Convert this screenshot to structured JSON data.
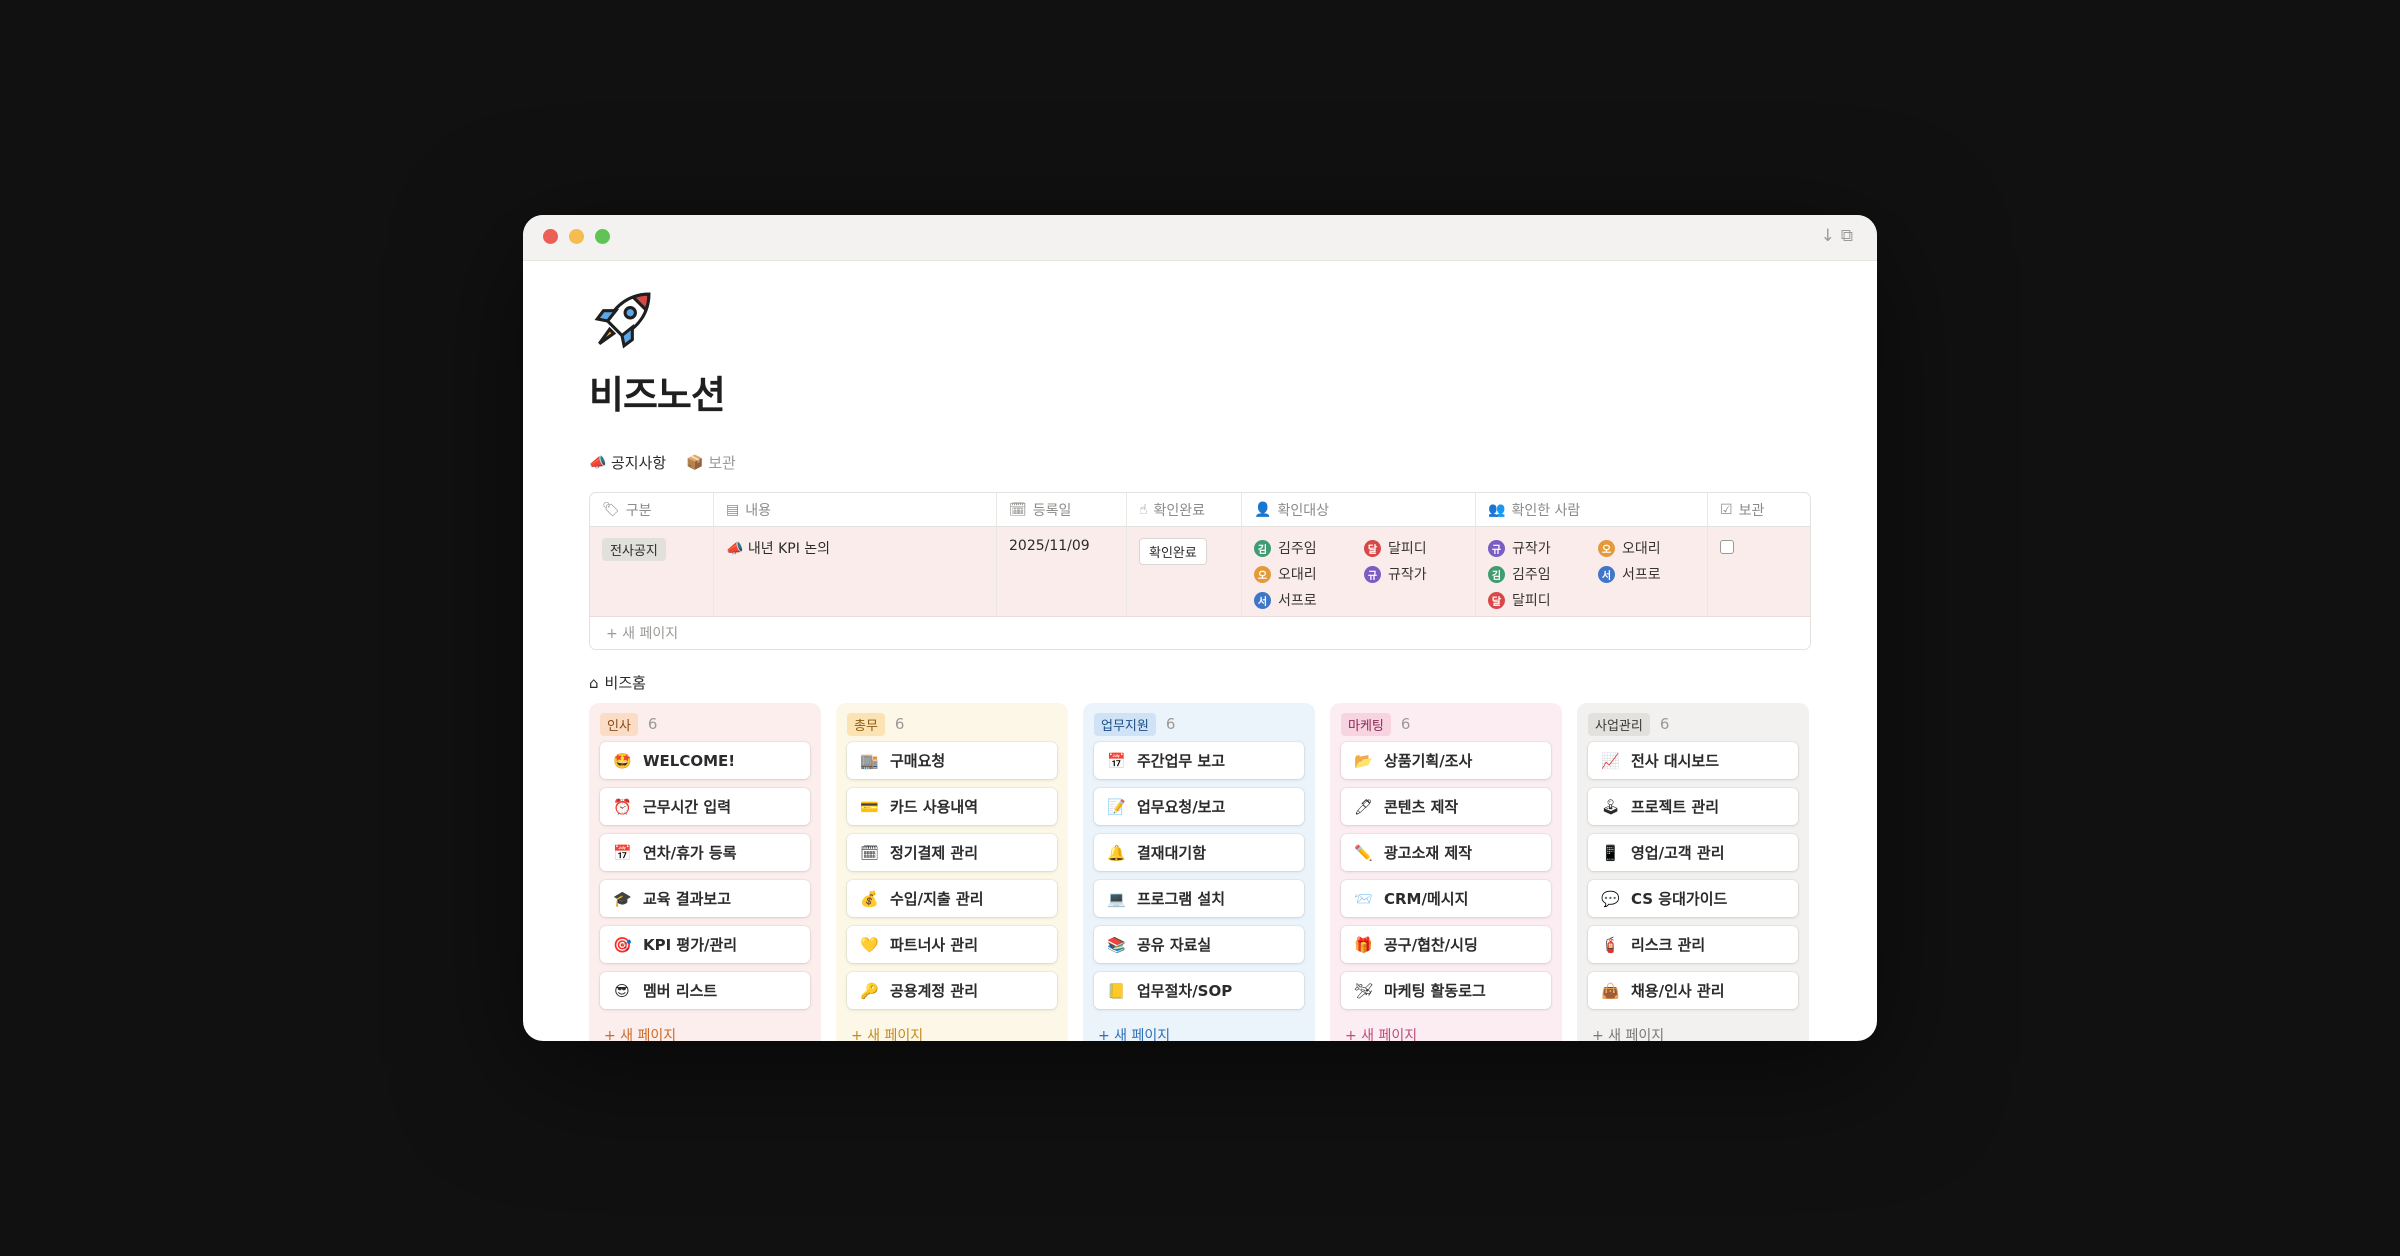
{
  "page": {
    "title": "비즈노션"
  },
  "tabs": [
    {
      "label": "공지사항",
      "icon": "megaphone-icon"
    },
    {
      "label": "보관",
      "icon": "box-icon"
    }
  ],
  "notice_table": {
    "columns": [
      "구분",
      "내용",
      "등록일",
      "확인완료",
      "확인대상",
      "확인한 사람",
      "보관"
    ],
    "rows": [
      {
        "category": "전사공지",
        "content": "내년 KPI 논의",
        "date": "2025/11/09",
        "confirm_button": "확인완료",
        "targets": [
          {
            "name": "김주임",
            "initial": "김",
            "color": "#3e9e72"
          },
          {
            "name": "달피디",
            "initial": "달",
            "color": "#d94848"
          },
          {
            "name": "오대리",
            "initial": "오",
            "color": "#e49a3a"
          },
          {
            "name": "규작가",
            "initial": "규",
            "color": "#7b5cc4"
          },
          {
            "name": "서프로",
            "initial": "서",
            "color": "#3f76c9"
          }
        ],
        "confirmed_by": [
          {
            "name": "규작가",
            "initial": "규",
            "color": "#7b5cc4"
          },
          {
            "name": "오대리",
            "initial": "오",
            "color": "#e49a3a"
          },
          {
            "name": "김주임",
            "initial": "김",
            "color": "#3e9e72"
          },
          {
            "name": "서프로",
            "initial": "서",
            "color": "#3f76c9"
          },
          {
            "name": "달피디",
            "initial": "달",
            "color": "#d94848"
          }
        ]
      }
    ],
    "new_page": "+ 새 페이지"
  },
  "bizhome": {
    "label": "비즈홈",
    "new_page": "+ 새 페이지",
    "columns": [
      {
        "name": "인사",
        "count": "6",
        "bg": "#fbeeec",
        "tag_bg": "#fbdcc4",
        "tag_color": "#8a4b18",
        "new_color": "#c96a2a",
        "cards": [
          {
            "label": "WELCOME!",
            "icon": "🤩"
          },
          {
            "label": "근무시간 입력",
            "icon": "⏰"
          },
          {
            "label": "연차/휴가 등록",
            "icon": "📅"
          },
          {
            "label": "교육 결과보고",
            "icon": "🎓"
          },
          {
            "label": "KPI 평가/관리",
            "icon": "🎯"
          },
          {
            "label": "멤버 리스트",
            "icon": "😎"
          }
        ]
      },
      {
        "name": "총무",
        "count": "6",
        "bg": "#fcf7e6",
        "tag_bg": "#fbe3b3",
        "tag_color": "#8a5a10",
        "new_color": "#c48a1f",
        "cards": [
          {
            "label": "구매요청",
            "icon": "🏬"
          },
          {
            "label": "카드 사용내역",
            "icon": "💳"
          },
          {
            "label": "정기결제 관리",
            "icon": "🗓"
          },
          {
            "label": "수입/지출 관리",
            "icon": "💰"
          },
          {
            "label": "파트너사 관리",
            "icon": "💛"
          },
          {
            "label": "공용계정 관리",
            "icon": "🔑"
          }
        ]
      },
      {
        "name": "업무지원",
        "count": "6",
        "bg": "#ebf3fb",
        "tag_bg": "#cfe2f6",
        "tag_color": "#1e4f86",
        "new_color": "#2f6fb8",
        "cards": [
          {
            "label": "주간업무 보고",
            "icon": "📅"
          },
          {
            "label": "업무요청/보고",
            "icon": "📝"
          },
          {
            "label": "결재대기함",
            "icon": "🔔"
          },
          {
            "label": "프로그램 설치",
            "icon": "💻"
          },
          {
            "label": "공유 자료실",
            "icon": "📚"
          },
          {
            "label": "업무절차/SOP",
            "icon": "📒"
          }
        ]
      },
      {
        "name": "마케팅",
        "count": "6",
        "bg": "#fcedf2",
        "tag_bg": "#f8d3e0",
        "tag_color": "#8c2a55",
        "new_color": "#c14a7a",
        "cards": [
          {
            "label": "상품기획/조사",
            "icon": "📂"
          },
          {
            "label": "콘텐츠 제작",
            "icon": "🖊"
          },
          {
            "label": "광고소재 제작",
            "icon": "✏️"
          },
          {
            "label": "CRM/메시지",
            "icon": "📨"
          },
          {
            "label": "공구/협찬/시딩",
            "icon": "🎁"
          },
          {
            "label": "마케팅 활동로그",
            "icon": "🛩"
          }
        ]
      },
      {
        "name": "사업관리",
        "count": "6",
        "bg": "#f2f1ef",
        "tag_bg": "#e3e1dd",
        "tag_color": "#3b3a37",
        "new_color": "#7a7875",
        "cards": [
          {
            "label": "전사 대시보드",
            "icon": "📈"
          },
          {
            "label": "프로젝트 관리",
            "icon": "🕹"
          },
          {
            "label": "영업/고객 관리",
            "icon": "📱"
          },
          {
            "label": "CS 응대가이드",
            "icon": "💬"
          },
          {
            "label": "리스크 관리",
            "icon": "🧯"
          },
          {
            "label": "채용/인사 관리",
            "icon": "👜"
          }
        ]
      }
    ]
  }
}
